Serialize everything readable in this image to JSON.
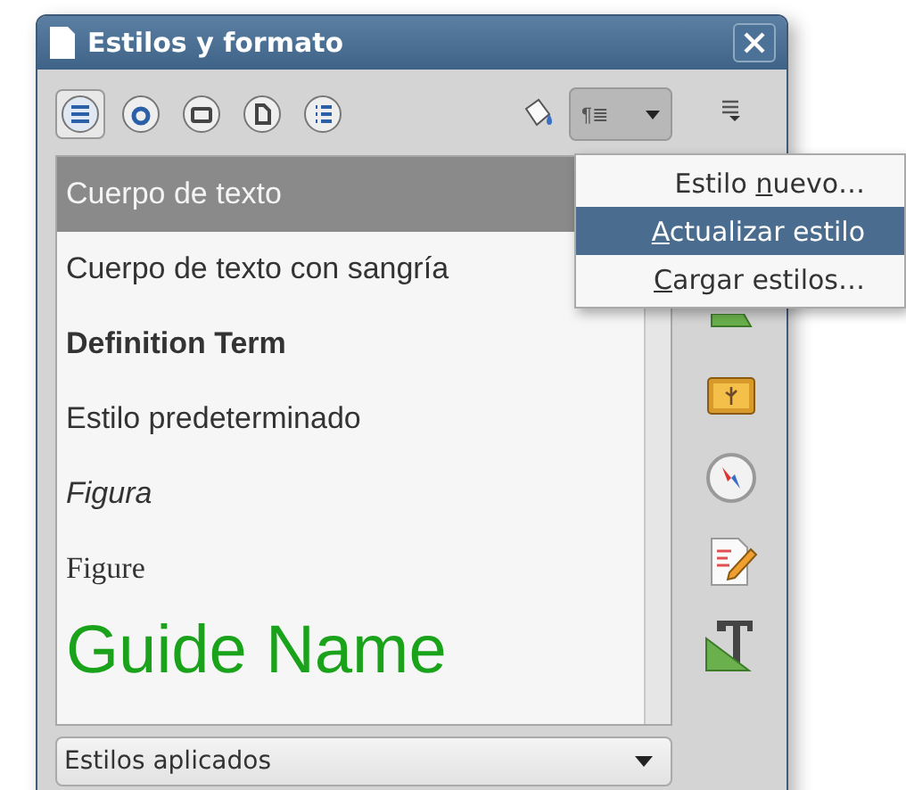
{
  "window": {
    "title": "Estilos y formato"
  },
  "toolbar": {
    "families": [
      {
        "kind": "paragraph",
        "selected": true
      },
      {
        "kind": "character",
        "selected": false
      },
      {
        "kind": "frame",
        "selected": false
      },
      {
        "kind": "page",
        "selected": false
      },
      {
        "kind": "list",
        "selected": false
      }
    ],
    "style_menu_button": {
      "label": "¶≣",
      "open": true
    }
  },
  "styles": [
    {
      "name": "Cuerpo de texto",
      "kind": "plain",
      "selected": true
    },
    {
      "name": "Cuerpo de texto con sangría",
      "kind": "plain",
      "selected": false
    },
    {
      "name": "Definition Term",
      "kind": "bold",
      "selected": false
    },
    {
      "name": "Estilo predeterminado",
      "kind": "plain",
      "selected": false
    },
    {
      "name": "Figura",
      "kind": "italic",
      "selected": false
    },
    {
      "name": "Figure",
      "kind": "serif",
      "selected": false
    },
    {
      "name": "Guide Name",
      "kind": "heading",
      "selected": false
    }
  ],
  "filter": {
    "value": "Estilos aplicados"
  },
  "menu": [
    {
      "before": "Estilo ",
      "key": "n",
      "after": "uevo…",
      "selected": false
    },
    {
      "key": "A",
      "after": "ctualizar estilo",
      "selected": true
    },
    {
      "key": "C",
      "after": "argar estilos…",
      "selected": false
    }
  ],
  "sidebar": [
    {
      "kind": "menu"
    },
    {
      "kind": "styles"
    },
    {
      "kind": "gallery"
    },
    {
      "kind": "navigator"
    },
    {
      "kind": "edit"
    },
    {
      "kind": "text"
    }
  ]
}
